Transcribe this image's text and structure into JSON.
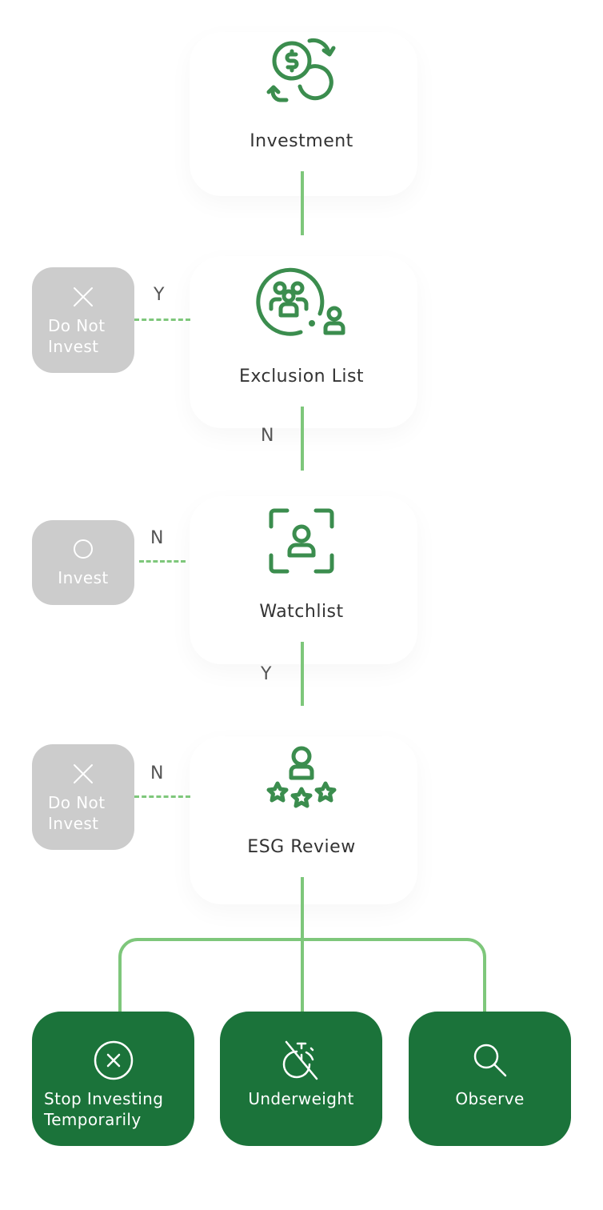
{
  "colors": {
    "icon_green": "#3b8d4e",
    "connector_green": "#7ec77b",
    "outcome_green": "#1b733a",
    "side_box_gray": "#cccccc",
    "label_text": "#333333"
  },
  "nodes": [
    {
      "id": "investment",
      "label": "Investment",
      "icon": "money-exchange-icon"
    },
    {
      "id": "exclusion",
      "label": "Exclusion List",
      "icon": "group-exclusion-icon"
    },
    {
      "id": "watchlist",
      "label": "Watchlist",
      "icon": "user-scan-icon"
    },
    {
      "id": "esg",
      "label": "ESG Review",
      "icon": "user-rating-icon"
    }
  ],
  "edges": {
    "exclusion_to_watchlist": "N",
    "watchlist_to_esg": "Y",
    "exclusion_side": "Y",
    "watchlist_side": "N",
    "esg_side": "N"
  },
  "side_outcomes": [
    {
      "label_line1": "Do Not",
      "label_line2": "Invest",
      "icon": "x-icon"
    },
    {
      "label_line1": "Invest",
      "icon": "circle-icon"
    },
    {
      "label_line1": "Do Not",
      "label_line2": "Invest",
      "icon": "x-icon"
    }
  ],
  "final_outcomes": [
    {
      "label_line1": "Stop Investing",
      "label_line2": "Temporarily",
      "icon": "circle-x-icon"
    },
    {
      "label_line1": "Underweight",
      "icon": "stopwatch-off-icon"
    },
    {
      "label_line1": "Observe",
      "icon": "search-icon"
    }
  ]
}
